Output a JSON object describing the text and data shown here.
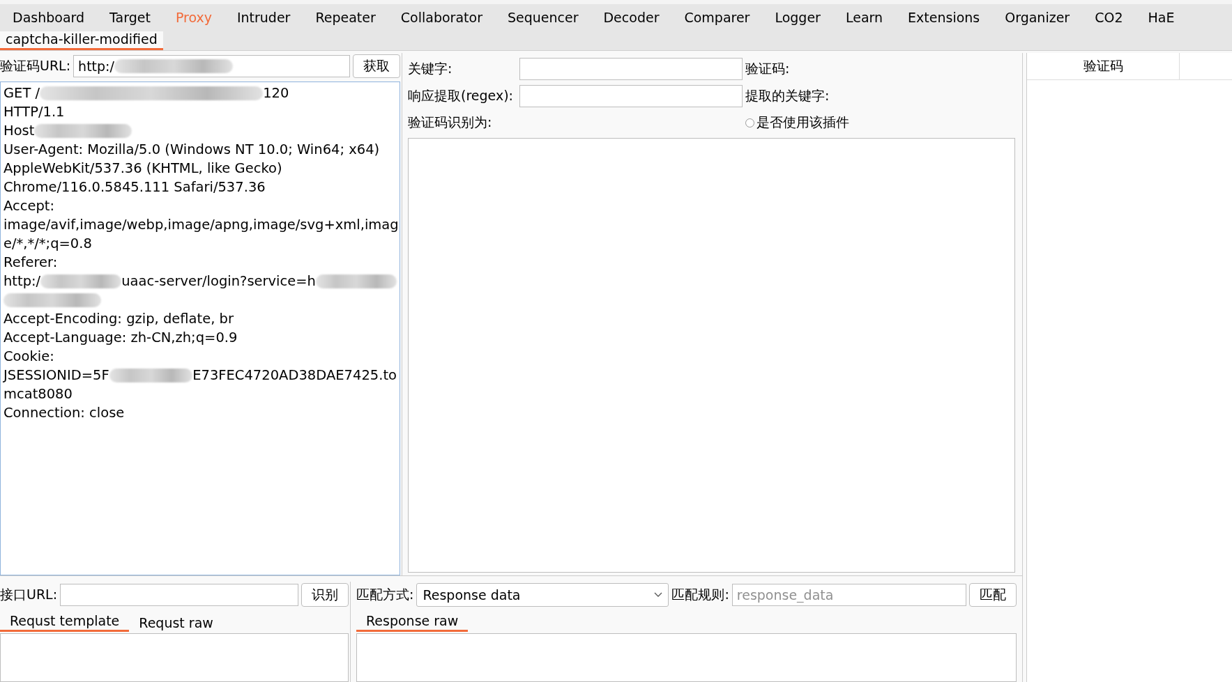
{
  "top_tabs": [
    {
      "label": "Dashboard",
      "selected": false
    },
    {
      "label": "Target",
      "selected": false
    },
    {
      "label": "Proxy",
      "selected": true
    },
    {
      "label": "Intruder",
      "selected": false
    },
    {
      "label": "Repeater",
      "selected": false
    },
    {
      "label": "Collaborator",
      "selected": false
    },
    {
      "label": "Sequencer",
      "selected": false
    },
    {
      "label": "Decoder",
      "selected": false
    },
    {
      "label": "Comparer",
      "selected": false
    },
    {
      "label": "Logger",
      "selected": false
    },
    {
      "label": "Learn",
      "selected": false
    },
    {
      "label": "Extensions",
      "selected": false
    },
    {
      "label": "Organizer",
      "selected": false
    },
    {
      "label": "CO2",
      "selected": false
    },
    {
      "label": "HaE",
      "selected": false
    }
  ],
  "sub_tabs": [
    {
      "label": "captcha-killer-modified",
      "selected": true
    }
  ],
  "captcha_fetch": {
    "label": "验证码URL:",
    "value": [
      {
        "kind": "text",
        "text": "http:/"
      },
      {
        "kind": "redacted"
      }
    ],
    "button": "获取"
  },
  "request_lines": [
    [
      {
        "kind": "text",
        "text": "GET /"
      },
      {
        "kind": "redacted"
      },
      {
        "kind": "text",
        "text": "120"
      }
    ],
    [
      {
        "kind": "text",
        "text": "HTTP/1.1"
      }
    ],
    [
      {
        "kind": "text",
        "text": "Host"
      },
      {
        "kind": "redacted"
      }
    ],
    [
      {
        "kind": "text",
        "text": "User-Agent: Mozilla/5.0 (Windows NT 10.0; Win64; x64)"
      }
    ],
    [
      {
        "kind": "text",
        "text": "AppleWebKit/537.36 (KHTML, like Gecko)"
      }
    ],
    [
      {
        "kind": "text",
        "text": "Chrome/116.0.5845.111 Safari/537.36"
      }
    ],
    [
      {
        "kind": "text",
        "text": "Accept:"
      }
    ],
    [
      {
        "kind": "text",
        "text": "image/avif,image/webp,image/apng,image/svg+xml,imag"
      }
    ],
    [
      {
        "kind": "text",
        "text": "e/*,*/*;q=0.8"
      }
    ],
    [
      {
        "kind": "text",
        "text": "Referer:"
      }
    ],
    [
      {
        "kind": "text",
        "text": "http:/"
      },
      {
        "kind": "redacted"
      },
      {
        "kind": "text",
        "text": "uaac-server/login?service=h"
      },
      {
        "kind": "redacted"
      }
    ],
    [
      {
        "kind": "redacted"
      }
    ],
    [
      {
        "kind": "text",
        "text": "Accept-Encoding: gzip, deflate, br"
      }
    ],
    [
      {
        "kind": "text",
        "text": "Accept-Language: zh-CN,zh;q=0.9"
      }
    ],
    [
      {
        "kind": "text",
        "text": "Cookie:"
      }
    ],
    [
      {
        "kind": "text",
        "text": "JSESSIONID=5F"
      },
      {
        "kind": "redacted"
      },
      {
        "kind": "text",
        "text": "E73FEC4720AD38DAE7425.to"
      }
    ],
    [
      {
        "kind": "text",
        "text": "mcat8080"
      }
    ],
    [
      {
        "kind": "text",
        "text": "Connection: close"
      }
    ]
  ],
  "keyword": {
    "label": "关键字:"
  },
  "captcha_label": "验证码:",
  "regex": {
    "label": "响应提取(regex):"
  },
  "extracted_label": "提取的关键字:",
  "recognized_label": "验证码识别为:",
  "use_plugin": {
    "label": "是否使用该插件",
    "checked": false
  },
  "results_table": {
    "columns": [
      "验证码"
    ]
  },
  "api": {
    "label": "接口URL:",
    "button": "识别"
  },
  "request_tabs": [
    {
      "label": "Requst template",
      "selected": true
    },
    {
      "label": "Requst raw",
      "selected": false
    }
  ],
  "match": {
    "mode_label": "匹配方式:",
    "mode_value": "Response data",
    "rule_label": "匹配规则:",
    "rule_placeholder": "response_data",
    "button": "匹配"
  },
  "response_tabs": [
    {
      "label": "Response raw",
      "selected": true
    }
  ]
}
